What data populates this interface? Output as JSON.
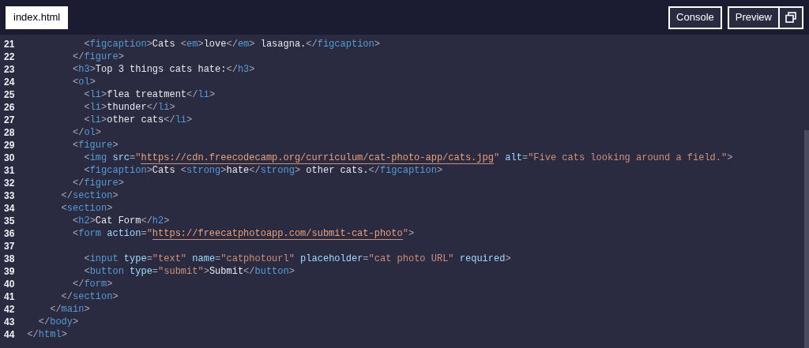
{
  "tabs": [
    {
      "label": "index.html",
      "selected": true
    }
  ],
  "buttons": [
    {
      "kind": "text",
      "label": "Console"
    },
    {
      "kind": "text",
      "label": "Preview"
    },
    {
      "kind": "icon"
    }
  ],
  "lines": [
    {
      "number": "21",
      "tokens": [
        {
          "kind": "punct",
          "text": "            <"
        },
        {
          "kind": "tag",
          "text": "figcaption"
        },
        {
          "kind": "punct",
          "text": ">"
        },
        {
          "kind": "text",
          "text": "Cats "
        },
        {
          "kind": "punct",
          "text": "<"
        },
        {
          "kind": "tag",
          "text": "em"
        },
        {
          "kind": "punct",
          "text": ">"
        },
        {
          "kind": "text",
          "text": "love"
        },
        {
          "kind": "punct",
          "text": "</"
        },
        {
          "kind": "tag",
          "text": "em"
        },
        {
          "kind": "punct",
          "text": ">"
        },
        {
          "kind": "text",
          "text": " lasagna."
        },
        {
          "kind": "punct",
          "text": "</"
        },
        {
          "kind": "tag",
          "text": "figcaption"
        },
        {
          "kind": "punct",
          "text": ">"
        }
      ]
    },
    {
      "number": "22",
      "tokens": [
        {
          "kind": "punct",
          "text": "          </"
        },
        {
          "kind": "tag",
          "text": "figure"
        },
        {
          "kind": "punct",
          "text": ">"
        }
      ]
    },
    {
      "number": "23",
      "tokens": [
        {
          "kind": "punct",
          "text": "          <"
        },
        {
          "kind": "tag",
          "text": "h3"
        },
        {
          "kind": "punct",
          "text": ">"
        },
        {
          "kind": "text",
          "text": "Top 3 things cats hate:"
        },
        {
          "kind": "punct",
          "text": "</"
        },
        {
          "kind": "tag",
          "text": "h3"
        },
        {
          "kind": "punct",
          "text": ">"
        }
      ]
    },
    {
      "number": "24",
      "tokens": [
        {
          "kind": "punct",
          "text": "          <"
        },
        {
          "kind": "tag",
          "text": "ol"
        },
        {
          "kind": "punct",
          "text": ">"
        }
      ]
    },
    {
      "number": "25",
      "tokens": [
        {
          "kind": "punct",
          "text": "            <"
        },
        {
          "kind": "tag",
          "text": "li"
        },
        {
          "kind": "punct",
          "text": ">"
        },
        {
          "kind": "text",
          "text": "flea treatment"
        },
        {
          "kind": "punct",
          "text": "</"
        },
        {
          "kind": "tag",
          "text": "li"
        },
        {
          "kind": "punct",
          "text": ">"
        }
      ]
    },
    {
      "number": "26",
      "tokens": [
        {
          "kind": "punct",
          "text": "            <"
        },
        {
          "kind": "tag",
          "text": "li"
        },
        {
          "kind": "punct",
          "text": ">"
        },
        {
          "kind": "text",
          "text": "thunder"
        },
        {
          "kind": "punct",
          "text": "</"
        },
        {
          "kind": "tag",
          "text": "li"
        },
        {
          "kind": "punct",
          "text": ">"
        }
      ]
    },
    {
      "number": "27",
      "tokens": [
        {
          "kind": "punct",
          "text": "            <"
        },
        {
          "kind": "tag",
          "text": "li"
        },
        {
          "kind": "punct",
          "text": ">"
        },
        {
          "kind": "text",
          "text": "other cats"
        },
        {
          "kind": "punct",
          "text": "</"
        },
        {
          "kind": "tag",
          "text": "li"
        },
        {
          "kind": "punct",
          "text": ">"
        }
      ]
    },
    {
      "number": "28",
      "tokens": [
        {
          "kind": "punct",
          "text": "          </"
        },
        {
          "kind": "tag",
          "text": "ol"
        },
        {
          "kind": "punct",
          "text": ">"
        }
      ]
    },
    {
      "number": "29",
      "tokens": [
        {
          "kind": "punct",
          "text": "          <"
        },
        {
          "kind": "tag",
          "text": "figure"
        },
        {
          "kind": "punct",
          "text": ">"
        }
      ]
    },
    {
      "number": "30",
      "tokens": [
        {
          "kind": "punct",
          "text": "            <"
        },
        {
          "kind": "tag",
          "text": "img"
        },
        {
          "kind": "attr",
          "text": " src"
        },
        {
          "kind": "punct",
          "text": "="
        },
        {
          "kind": "string",
          "text": "\""
        },
        {
          "kind": "url",
          "text": "https://cdn.freecodecamp.org/curriculum/cat-photo-app/cats.jpg"
        },
        {
          "kind": "string",
          "text": "\""
        },
        {
          "kind": "attr",
          "text": " alt"
        },
        {
          "kind": "punct",
          "text": "="
        },
        {
          "kind": "string",
          "text": "\"Five cats looking around a field.\""
        },
        {
          "kind": "punct",
          "text": ">"
        }
      ]
    },
    {
      "number": "31",
      "tokens": [
        {
          "kind": "punct",
          "text": "            <"
        },
        {
          "kind": "tag",
          "text": "figcaption"
        },
        {
          "kind": "punct",
          "text": ">"
        },
        {
          "kind": "text",
          "text": "Cats "
        },
        {
          "kind": "punct",
          "text": "<"
        },
        {
          "kind": "tag",
          "text": "strong"
        },
        {
          "kind": "punct",
          "text": ">"
        },
        {
          "kind": "text",
          "text": "hate"
        },
        {
          "kind": "punct",
          "text": "</"
        },
        {
          "kind": "tag",
          "text": "strong"
        },
        {
          "kind": "punct",
          "text": ">"
        },
        {
          "kind": "text",
          "text": " other cats."
        },
        {
          "kind": "punct",
          "text": "</"
        },
        {
          "kind": "tag",
          "text": "figcaption"
        },
        {
          "kind": "punct",
          "text": ">"
        }
      ]
    },
    {
      "number": "32",
      "tokens": [
        {
          "kind": "punct",
          "text": "          </"
        },
        {
          "kind": "tag",
          "text": "figure"
        },
        {
          "kind": "punct",
          "text": ">"
        }
      ]
    },
    {
      "number": "33",
      "tokens": [
        {
          "kind": "punct",
          "text": "        </"
        },
        {
          "kind": "tag",
          "text": "section"
        },
        {
          "kind": "punct",
          "text": ">"
        }
      ]
    },
    {
      "number": "34",
      "tokens": [
        {
          "kind": "punct",
          "text": "        <"
        },
        {
          "kind": "tag",
          "text": "section"
        },
        {
          "kind": "punct",
          "text": ">"
        }
      ]
    },
    {
      "number": "35",
      "tokens": [
        {
          "kind": "punct",
          "text": "          <"
        },
        {
          "kind": "tag",
          "text": "h2"
        },
        {
          "kind": "punct",
          "text": ">"
        },
        {
          "kind": "text",
          "text": "Cat Form"
        },
        {
          "kind": "punct",
          "text": "</"
        },
        {
          "kind": "tag",
          "text": "h2"
        },
        {
          "kind": "punct",
          "text": ">"
        }
      ]
    },
    {
      "number": "36",
      "tokens": [
        {
          "kind": "punct",
          "text": "          <"
        },
        {
          "kind": "tag",
          "text": "form"
        },
        {
          "kind": "attr",
          "text": " action"
        },
        {
          "kind": "punct",
          "text": "="
        },
        {
          "kind": "string",
          "text": "\""
        },
        {
          "kind": "url",
          "text": "https://freecatphotoapp.com/submit-cat-photo"
        },
        {
          "kind": "string",
          "text": "\""
        },
        {
          "kind": "punct",
          "text": ">"
        }
      ]
    },
    {
      "number": "37"
    },
    {
      "number": "38",
      "tokens": [
        {
          "kind": "punct",
          "text": "            <"
        },
        {
          "kind": "tag",
          "text": "input"
        },
        {
          "kind": "attr",
          "text": " type"
        },
        {
          "kind": "punct",
          "text": "="
        },
        {
          "kind": "string",
          "text": "\"text\""
        },
        {
          "kind": "attr",
          "text": " name"
        },
        {
          "kind": "punct",
          "text": "="
        },
        {
          "kind": "string",
          "text": "\"catphotourl\""
        },
        {
          "kind": "attr",
          "text": " placeholder"
        },
        {
          "kind": "punct",
          "text": "="
        },
        {
          "kind": "string",
          "text": "\"cat photo URL\""
        },
        {
          "kind": "attr",
          "text": " required"
        },
        {
          "kind": "punct",
          "text": ">"
        }
      ]
    },
    {
      "number": "39",
      "tokens": [
        {
          "kind": "punct",
          "text": "            <"
        },
        {
          "kind": "tag",
          "text": "button"
        },
        {
          "kind": "attr",
          "text": " type"
        },
        {
          "kind": "punct",
          "text": "="
        },
        {
          "kind": "string",
          "text": "\"submit\""
        },
        {
          "kind": "punct",
          "text": ">"
        },
        {
          "kind": "text",
          "text": "Submit"
        },
        {
          "kind": "punct",
          "text": "</"
        },
        {
          "kind": "tag",
          "text": "button"
        },
        {
          "kind": "punct",
          "text": ">"
        }
      ]
    },
    {
      "number": "40",
      "tokens": [
        {
          "kind": "punct",
          "text": "          </"
        },
        {
          "kind": "tag",
          "text": "form"
        },
        {
          "kind": "punct",
          "text": ">"
        }
      ]
    },
    {
      "number": "41",
      "tokens": [
        {
          "kind": "punct",
          "text": "        </"
        },
        {
          "kind": "tag",
          "text": "section"
        },
        {
          "kind": "punct",
          "text": ">"
        }
      ]
    },
    {
      "number": "42",
      "tokens": [
        {
          "kind": "punct",
          "text": "      </"
        },
        {
          "kind": "tag",
          "text": "main"
        },
        {
          "kind": "punct",
          "text": ">"
        }
      ]
    },
    {
      "number": "43",
      "tokens": [
        {
          "kind": "punct",
          "text": "    </"
        },
        {
          "kind": "tag",
          "text": "body"
        },
        {
          "kind": "punct",
          "text": ">"
        }
      ]
    },
    {
      "number": "44",
      "tokens": [
        {
          "kind": "punct",
          "text": "  </"
        },
        {
          "kind": "tag",
          "text": "html"
        },
        {
          "kind": "punct",
          "text": ">"
        }
      ]
    }
  ]
}
